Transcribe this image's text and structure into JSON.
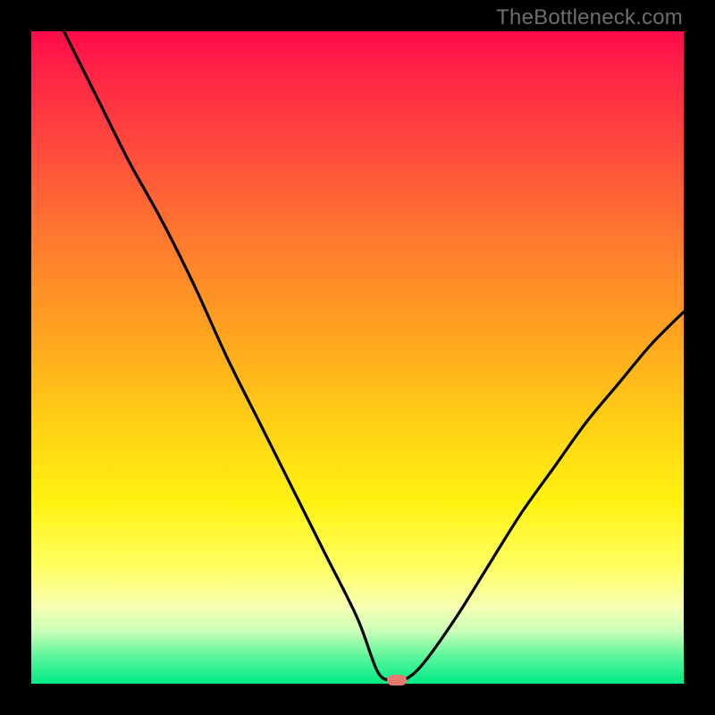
{
  "watermark": "TheBottleneck.com",
  "colors": {
    "frame": "#000000",
    "curve": "#000000",
    "marker": "#e67a6e",
    "gradient_stops": [
      "#ff0a4a",
      "#ff2345",
      "#ff4a3d",
      "#ff7a2e",
      "#ffa21f",
      "#ffd014",
      "#fff210",
      "#ffff60",
      "#f7ffb0",
      "#c9ffb8",
      "#57f59a",
      "#00ea86"
    ]
  },
  "chart_data": {
    "type": "line",
    "title": "",
    "xlabel": "",
    "ylabel": "",
    "xlim": [
      0,
      100
    ],
    "ylim": [
      0,
      100
    ],
    "series": [
      {
        "name": "bottleneck-curve",
        "x": [
          5,
          10,
          15,
          20,
          25,
          30,
          35,
          40,
          45,
          50,
          53,
          55,
          57,
          60,
          65,
          70,
          75,
          80,
          85,
          90,
          95,
          100
        ],
        "y": [
          100,
          90,
          80,
          71,
          61,
          50,
          40,
          30,
          20,
          10,
          2,
          0.5,
          0.5,
          3,
          10,
          18,
          26,
          33,
          40,
          46,
          52,
          57
        ]
      }
    ],
    "marker": {
      "x": 56,
      "y": 0.5
    },
    "annotations": []
  }
}
